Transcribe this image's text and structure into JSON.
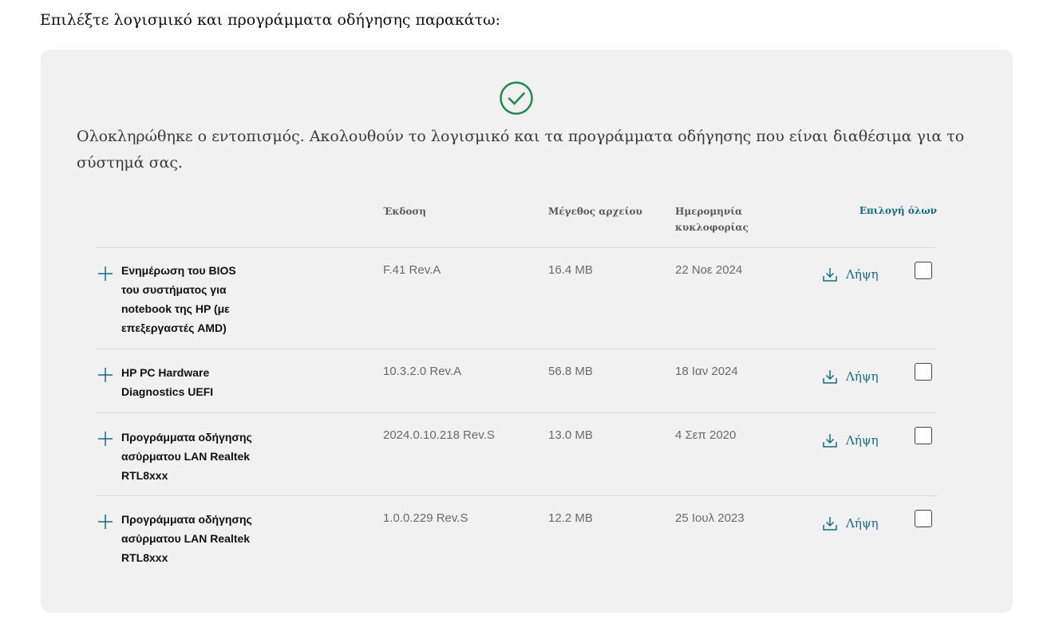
{
  "page": {
    "heading": "Επιλέξτε λογισμικό και προγράμματα οδήγησης παρακάτω:"
  },
  "panel": {
    "status_icon": "check-circle-icon",
    "status_message": "Ολοκληρώθηκε ο εντοπισμός. Ακολουθούν το λογισμικό και τα προγράμματα οδήγησης που είναι διαθέσιμα για το σύστημά σας."
  },
  "table": {
    "columns": {
      "version": "Έκδοση",
      "file_size": "Μέγεθος αρχείου",
      "release_date": "Ημερομηνία κυκλοφορίας"
    },
    "select_all": "Επιλογή όλων",
    "rows": [
      {
        "name": "Ενημέρωση του BIOS του συστήματος για notebook της HP (με επεξεργαστές AMD)",
        "version": "F.41 Rev.A",
        "size": "16.4 MB",
        "date": "22 Νοε 2024",
        "download_label": "Λήψη",
        "checked": false
      },
      {
        "name": "HP PC Hardware Diagnostics UEFI",
        "version": "10.3.2.0 Rev.A",
        "size": "56.8 MB",
        "date": "18 Ιαν 2024",
        "download_label": "Λήψη",
        "checked": false
      },
      {
        "name": "Προγράμματα οδήγησης ασύρματου LAN Realtek RTL8xxx",
        "version": "2024.0.10.218 Rev.S",
        "size": "13.0 MB",
        "date": "4 Σεπ 2020",
        "download_label": "Λήψη",
        "checked": false
      },
      {
        "name": "Προγράμματα οδήγησης ασύρματου LAN Realtek RTL8xxx",
        "version": "1.0.0.229 Rev.S",
        "size": "12.2 MB",
        "date": "25 Ιουλ 2023",
        "download_label": "Λήψη",
        "checked": false
      }
    ]
  },
  "colors": {
    "accent": "#0f6c8a",
    "success": "#1d8a4e",
    "panel_bg": "#f1f1f1"
  }
}
